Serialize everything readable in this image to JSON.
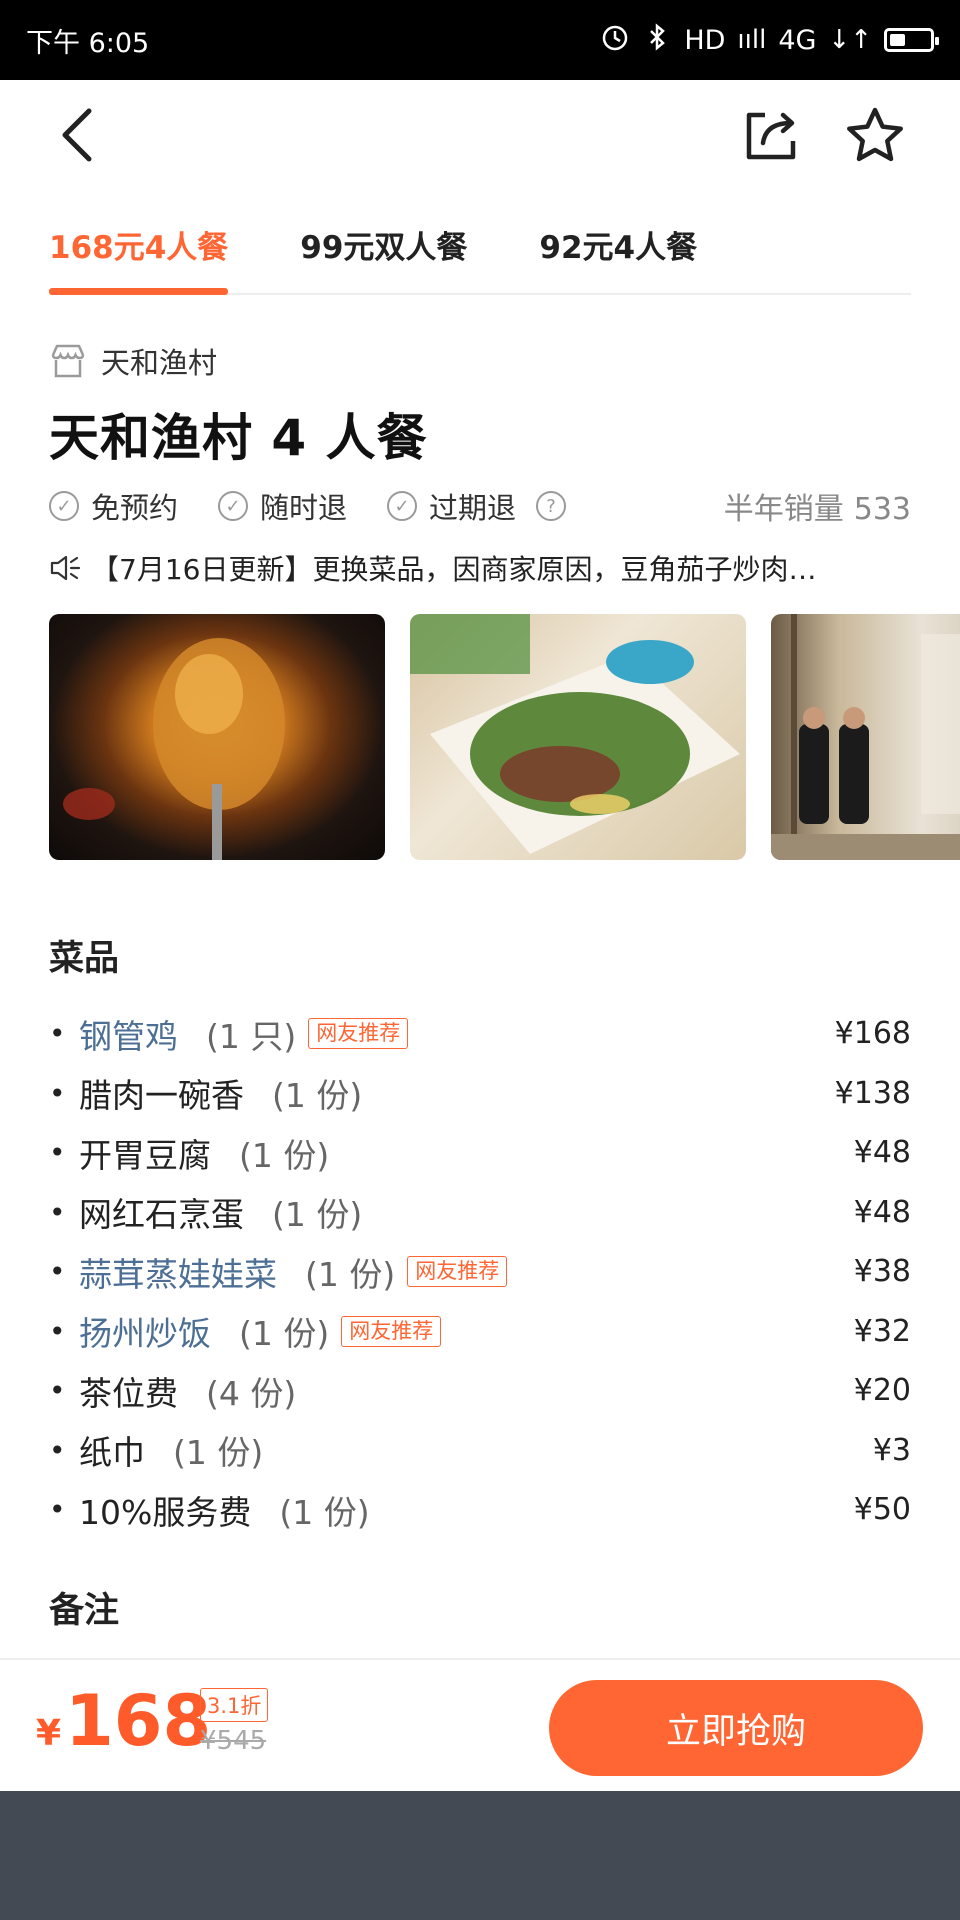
{
  "status_bar": {
    "time": "下午 6:05",
    "network_hd": "HD",
    "signal": "ııll",
    "network": "4G",
    "data_icon": "↓↑",
    "battery_level": 0.35
  },
  "nav": {
    "back_icon": "chevron-left",
    "share_icon": "share",
    "favorite_icon": "star"
  },
  "tabs": [
    {
      "label": "168元4人餐",
      "active": true
    },
    {
      "label": "99元双人餐",
      "active": false
    },
    {
      "label": "92元4人餐",
      "active": false
    }
  ],
  "shop": {
    "name": "天和渔村",
    "title": "天和渔村 4 人餐"
  },
  "features": [
    {
      "label": "免预约"
    },
    {
      "label": "随时退"
    },
    {
      "label": "过期退"
    }
  ],
  "sales": {
    "label": "半年销量",
    "count": "533"
  },
  "notice": "【7月16日更新】更换菜品，因商家原因，豆角茄子炒肉…",
  "photos": [
    {
      "alt": "roasted chicken"
    },
    {
      "alt": "green beans stir-fry"
    },
    {
      "alt": "restaurant entrance"
    }
  ],
  "dishes_title": "菜品",
  "dishes": [
    {
      "name": "钢管鸡",
      "qty": "(1 只)",
      "tag": "网友推荐",
      "price": "¥168",
      "highlight": true
    },
    {
      "name": "腊肉一碗香",
      "qty": "(1 份)",
      "tag": "",
      "price": "¥138",
      "highlight": false
    },
    {
      "name": "开胃豆腐",
      "qty": "(1 份)",
      "tag": "",
      "price": "¥48",
      "highlight": false
    },
    {
      "name": "网红石烹蛋",
      "qty": "(1 份)",
      "tag": "",
      "price": "¥48",
      "highlight": false
    },
    {
      "name": "蒜茸蒸娃娃菜",
      "qty": "(1 份)",
      "tag": "网友推荐",
      "price": "¥38",
      "highlight": true
    },
    {
      "name": "扬州炒饭",
      "qty": "(1 份)",
      "tag": "网友推荐",
      "price": "¥32",
      "highlight": true
    },
    {
      "name": "茶位费",
      "qty": "(4 份)",
      "tag": "",
      "price": "¥20",
      "highlight": false
    },
    {
      "name": "纸巾",
      "qty": "(1 份)",
      "tag": "",
      "price": "¥3",
      "highlight": false
    },
    {
      "name": "10%服务费",
      "qty": "(1 份)",
      "tag": "",
      "price": "¥50",
      "highlight": false
    }
  ],
  "remarks_title": "备注",
  "bottom": {
    "currency": "¥",
    "price": "168",
    "discount": "3.1折",
    "original_price": "¥545",
    "buy_label": "立即抢购"
  },
  "colors": {
    "accent": "#ff6633",
    "link": "#4d6f95"
  }
}
